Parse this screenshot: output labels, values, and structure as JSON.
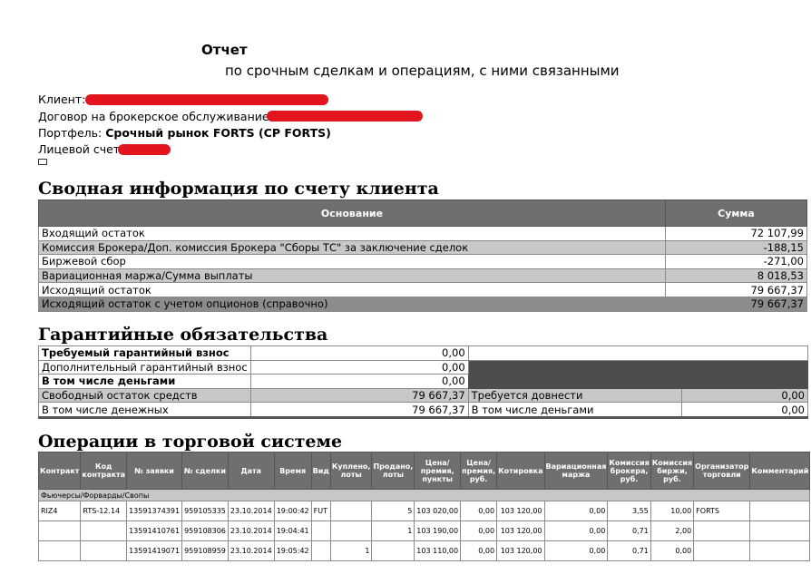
{
  "header": {
    "title": "Отчет",
    "subtitle": "по срочным сделкам и операциям, с ними связанными"
  },
  "client_info": {
    "client_label": "Клиент:",
    "contract_label": "Договор на брокерское обслуживание:",
    "portfolio_label": "Портфель:",
    "portfolio_value": "Срочный рынок FORTS (СР FORTS)",
    "account_label": "Лицевой счет:"
  },
  "summary": {
    "heading": "Сводная информация по счету клиента",
    "col_basis": "Основание",
    "col_sum": "Сумма",
    "rows": [
      {
        "label": "Входящий остаток",
        "value": "72 107,99"
      },
      {
        "label": "Комиссия Брокера/Доп. комиссия Брокера \"Сборы ТС\" за заключение сделок",
        "value": "-188,15"
      },
      {
        "label": "Биржевой сбор",
        "value": "-271,00"
      },
      {
        "label": "Вариационная маржа/Сумма выплаты",
        "value": "8 018,53"
      },
      {
        "label": "Исходящий остаток",
        "value": "79 667,37"
      },
      {
        "label": "Исходящий остаток с учетом опционов (справочно)",
        "value": "79 667,37"
      }
    ]
  },
  "guarantee": {
    "heading": "Гарантийные обязательства",
    "rows": [
      {
        "label": "Требуемый гарантийный взнос",
        "value": "0,00"
      },
      {
        "label": "Дополнительный гарантийный взнос",
        "value": "0,00"
      },
      {
        "label": "В том числе деньгами",
        "value": "0,00"
      },
      {
        "label": "Свободный остаток средств",
        "value": "79 667,37",
        "label2": "Требуется довнести",
        "value2": "0,00"
      },
      {
        "label": "В том числе денежных",
        "value": "79 667,37",
        "label2": "В том числе деньгами",
        "value2": "0,00"
      }
    ]
  },
  "operations": {
    "heading": "Операции в торговой системе",
    "columns": [
      "Контракт",
      "Код контракта",
      "№ заявки",
      "№ сделки",
      "Дата",
      "Время",
      "Вид",
      "Куплено, лоты",
      "Продано, лоты",
      "Цена/премия, пункты",
      "Цена/премия, руб.",
      "Котировка",
      "Вариационная маржа",
      "Комиссия брокера, руб.",
      "Комиссия биржи, руб.",
      "Организатор торговли",
      "Комментарий"
    ],
    "section": "Фьючерсы/Форварды/Свопы",
    "rows": [
      [
        "RIZ4",
        "RTS-12.14",
        "13591374391",
        "959105335",
        "23.10.2014",
        "19:00:42",
        "FUT",
        "",
        "5",
        "103 020,00",
        "0,00",
        "103 120,00",
        "0,00",
        "3,55",
        "10,00",
        "FORTS",
        ""
      ],
      [
        "",
        "",
        "13591410761",
        "959108306",
        "23.10.2014",
        "19:04:41",
        "",
        "",
        "1",
        "103 190,00",
        "0,00",
        "103 120,00",
        "0,00",
        "0,71",
        "2,00",
        "",
        ""
      ],
      [
        "",
        "",
        "13591419071",
        "959108959",
        "23.10.2014",
        "19:05:42",
        "",
        "1",
        "",
        "103 110,00",
        "0,00",
        "103 120,00",
        "0,00",
        "0,71",
        "0,00",
        "",
        ""
      ]
    ]
  }
}
